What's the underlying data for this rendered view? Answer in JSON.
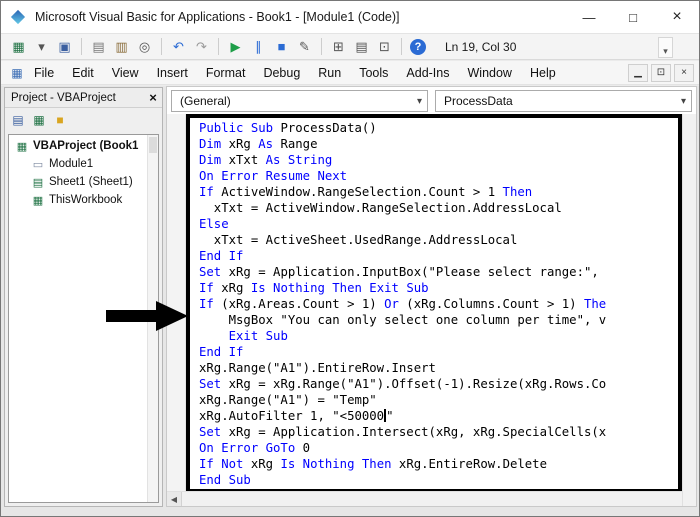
{
  "window": {
    "title": "Microsoft Visual Basic for Applications - Book1 - [Module1 (Code)]",
    "minimize": "—",
    "maximize": "□",
    "close": "×"
  },
  "toolbar": {
    "position": "Ln 19, Col 30",
    "overflow_glyph": "▾",
    "icons": [
      {
        "name": "view-excel-icon",
        "glyph": "▦",
        "color": "#1f7244"
      },
      {
        "name": "view-dropdown-icon",
        "glyph": "▾",
        "color": "#555555"
      },
      {
        "name": "save-icon",
        "glyph": "▣",
        "color": "#3b5fa0"
      },
      {
        "name": "separator"
      },
      {
        "name": "copy-icon",
        "glyph": "▤",
        "color": "#777777"
      },
      {
        "name": "paste-icon",
        "glyph": "▥",
        "color": "#8a6d3b"
      },
      {
        "name": "find-icon",
        "glyph": "◎",
        "color": "#555555"
      },
      {
        "name": "separator"
      },
      {
        "name": "undo-icon",
        "glyph": "↶",
        "color": "#2b6bd4"
      },
      {
        "name": "redo-icon",
        "glyph": "↷",
        "color": "#9a9a9a"
      },
      {
        "name": "separator"
      },
      {
        "name": "run-icon",
        "glyph": "▶",
        "color": "#1e9e48"
      },
      {
        "name": "break-icon",
        "glyph": "∥",
        "color": "#2b6bd4"
      },
      {
        "name": "reset-icon",
        "glyph": "■",
        "color": "#2b6bd4"
      },
      {
        "name": "design-mode-icon",
        "glyph": "✎",
        "color": "#555555"
      },
      {
        "name": "separator"
      },
      {
        "name": "project-explorer-icon",
        "glyph": "⊞",
        "color": "#555555"
      },
      {
        "name": "properties-window-icon",
        "glyph": "▤",
        "color": "#555555"
      },
      {
        "name": "object-browser-icon",
        "glyph": "⊡",
        "color": "#555555"
      },
      {
        "name": "separator"
      },
      {
        "name": "help-icon",
        "glyph": "?",
        "color": "#ffffff",
        "circle": true,
        "bg": "#2b6bd4"
      }
    ]
  },
  "menubar": {
    "window_icon_glyph": "▦",
    "items": [
      "File",
      "Edit",
      "View",
      "Insert",
      "Format",
      "Debug",
      "Run",
      "Tools",
      "Add-Ins",
      "Window",
      "Help"
    ],
    "child_minimize": "▁",
    "child_restore": "⊡",
    "child_close": "×"
  },
  "project_panel": {
    "title": "Project - VBAProject",
    "close": "×",
    "toolbar_icons": [
      {
        "name": "view-code-icon",
        "glyph": "▤",
        "color": "#3b5fa0"
      },
      {
        "name": "view-object-icon",
        "glyph": "▦",
        "color": "#1f7244"
      },
      {
        "name": "toggle-folders-icon",
        "glyph": "■",
        "color": "#d9a521"
      }
    ],
    "tree": [
      {
        "id": "vbaproject-book1",
        "label": "VBAProject (Book1",
        "icon": "workbook",
        "bold": true,
        "indent": 0
      },
      {
        "id": "module1",
        "label": "Module1",
        "icon": "module",
        "bold": false,
        "indent": 1
      },
      {
        "id": "sheet1",
        "label": "Sheet1 (Sheet1)",
        "icon": "sheet",
        "bold": false,
        "indent": 1
      },
      {
        "id": "thisworkbook",
        "label": "ThisWorkbook",
        "icon": "workbook",
        "bold": false,
        "indent": 1
      }
    ]
  },
  "code_pane": {
    "object_dropdown": "(General)",
    "procedure_dropdown": "ProcessData",
    "dropdown_arrow": "▾",
    "scroll_left": "◀",
    "keyword_color": "#0000ff",
    "text_color": "#000000",
    "lines": [
      [
        {
          "t": "k",
          "s": "Public Sub"
        },
        {
          "t": "n",
          "s": " ProcessData()"
        }
      ],
      [
        {
          "t": "k",
          "s": "Dim"
        },
        {
          "t": "n",
          "s": " xRg "
        },
        {
          "t": "k",
          "s": "As"
        },
        {
          "t": "n",
          "s": " Range"
        }
      ],
      [
        {
          "t": "k",
          "s": "Dim"
        },
        {
          "t": "n",
          "s": " xTxt "
        },
        {
          "t": "k",
          "s": "As String"
        }
      ],
      [
        {
          "t": "k",
          "s": "On Error Resume Next"
        }
      ],
      [
        {
          "t": "k",
          "s": "If"
        },
        {
          "t": "n",
          "s": " ActiveWindow.RangeSelection.Count > 1 "
        },
        {
          "t": "k",
          "s": "Then"
        }
      ],
      [
        {
          "t": "n",
          "s": "  xTxt = ActiveWindow.RangeSelection.AddressLocal"
        }
      ],
      [
        {
          "t": "k",
          "s": "Else"
        }
      ],
      [
        {
          "t": "n",
          "s": "  xTxt = ActiveSheet.UsedRange.AddressLocal"
        }
      ],
      [
        {
          "t": "k",
          "s": "End If"
        }
      ],
      [
        {
          "t": "k",
          "s": "Set"
        },
        {
          "t": "n",
          "s": " xRg = Application.InputBox(\"Please select range:\","
        }
      ],
      [
        {
          "t": "k",
          "s": "If"
        },
        {
          "t": "n",
          "s": " xRg "
        },
        {
          "t": "k",
          "s": "Is Nothing Then Exit Sub"
        }
      ],
      [
        {
          "t": "k",
          "s": "If"
        },
        {
          "t": "n",
          "s": " (xRg.Areas.Count > 1) "
        },
        {
          "t": "k",
          "s": "Or"
        },
        {
          "t": "n",
          "s": " (xRg.Columns.Count > 1) "
        },
        {
          "t": "k",
          "s": "The"
        }
      ],
      [
        {
          "t": "n",
          "s": "    MsgBox \"You can only select one column per time\", v"
        }
      ],
      [
        {
          "t": "n",
          "s": "    "
        },
        {
          "t": "k",
          "s": "Exit Sub"
        }
      ],
      [
        {
          "t": "k",
          "s": "End If"
        }
      ],
      [
        {
          "t": "n",
          "s": "xRg.Range(\"A1\").EntireRow.Insert"
        }
      ],
      [
        {
          "t": "k",
          "s": "Set"
        },
        {
          "t": "n",
          "s": " xRg = xRg.Range(\"A1\").Offset(-1).Resize(xRg.Rows.Co"
        }
      ],
      [
        {
          "t": "n",
          "s": "xRg.Range(\"A1\") = \"Temp\""
        }
      ],
      [
        {
          "t": "n",
          "s": "xRg.AutoFilter 1, \"<50000"
        },
        {
          "t": "c"
        },
        {
          "t": "n",
          "s": "\""
        }
      ],
      [
        {
          "t": "k",
          "s": "Set"
        },
        {
          "t": "n",
          "s": " xRg = Application.Intersect(xRg, xRg.SpecialCells(x"
        }
      ],
      [
        {
          "t": "k",
          "s": "On Error GoTo"
        },
        {
          "t": "n",
          "s": " 0"
        }
      ],
      [
        {
          "t": "k",
          "s": "If Not"
        },
        {
          "t": "n",
          "s": " xRg "
        },
        {
          "t": "k",
          "s": "Is Nothing Then"
        },
        {
          "t": "n",
          "s": " xRg.EntireRow.Delete"
        }
      ],
      [
        {
          "t": "k",
          "s": "End Sub"
        }
      ]
    ]
  }
}
